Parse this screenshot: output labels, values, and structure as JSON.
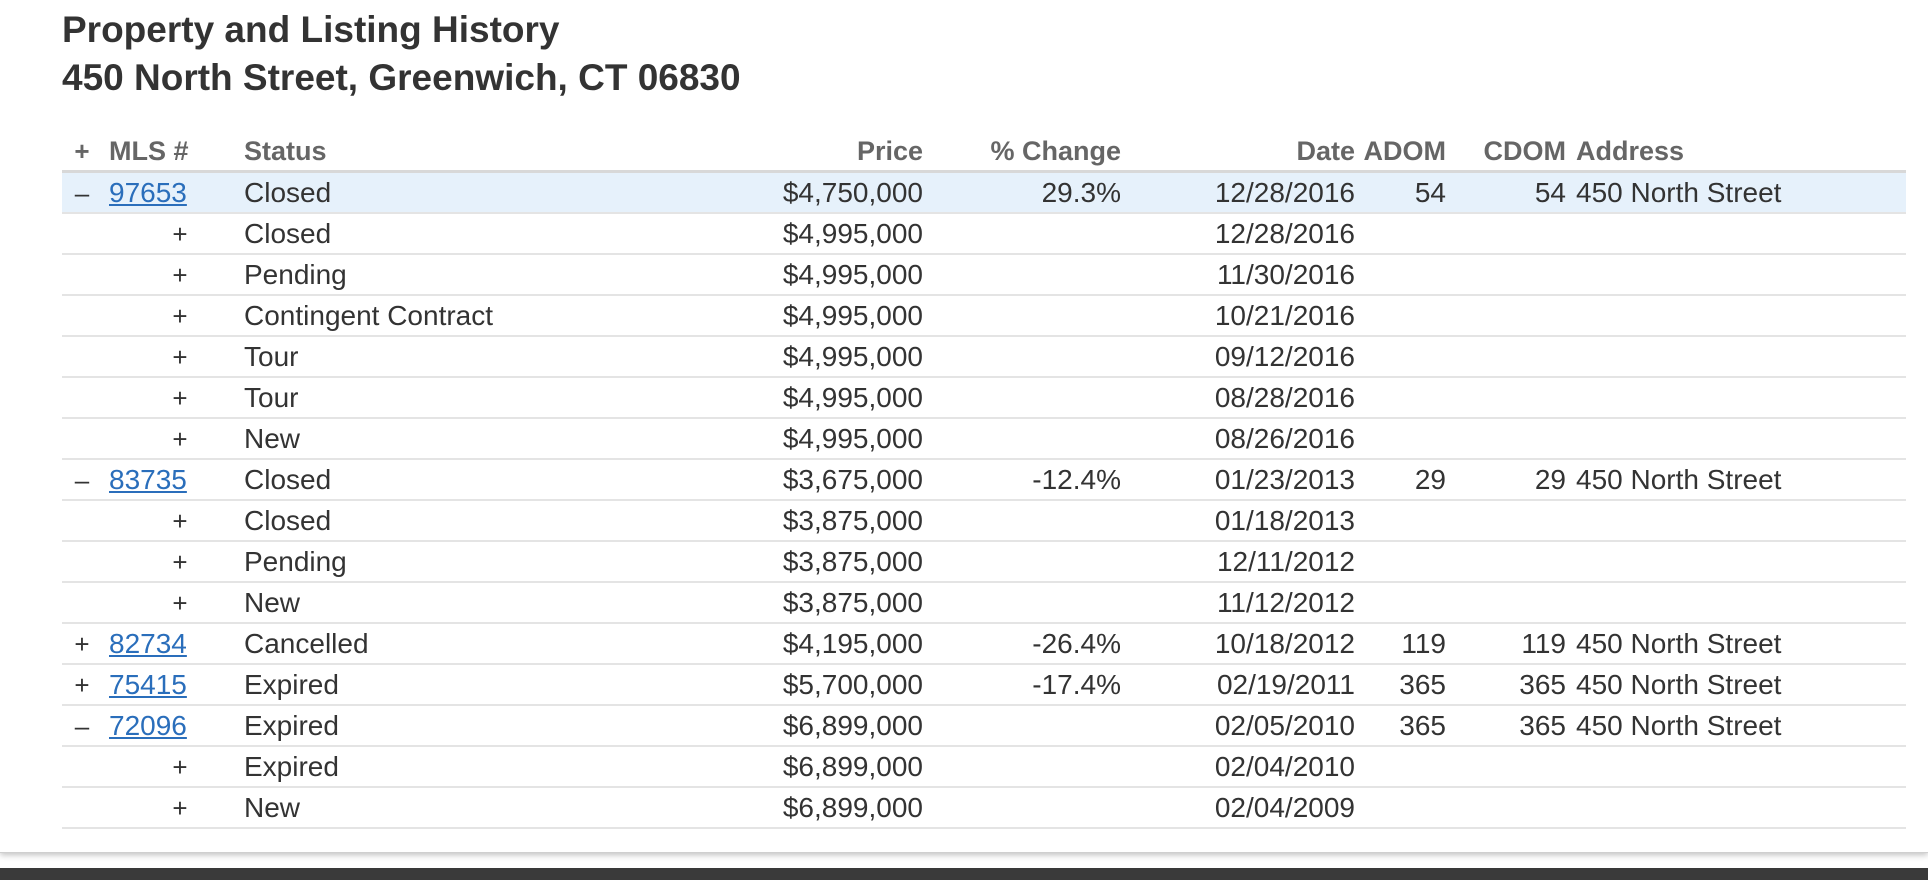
{
  "header": {
    "title": "Property and Listing History",
    "address": "450 North Street, Greenwich, CT 06830"
  },
  "table": {
    "columns": {
      "toggle": "+",
      "mls": "MLS #",
      "status": "Status",
      "price": "Price",
      "change": "% Change",
      "date": "Date",
      "adom": "ADOM",
      "cdom": "CDOM",
      "address": "Address"
    },
    "rows": [
      {
        "kind": "parent",
        "toggle": "–",
        "mls": "97653",
        "status": "Closed",
        "price": "$4,750,000",
        "change": "29.3%",
        "date": "12/28/2016",
        "adom": "54",
        "cdom": "54",
        "address": "450 North Street",
        "highlight": true
      },
      {
        "kind": "child",
        "toggle": "+",
        "status": "Closed",
        "price": "$4,995,000",
        "date": "12/28/2016"
      },
      {
        "kind": "child",
        "toggle": "+",
        "status": "Pending",
        "price": "$4,995,000",
        "date": "11/30/2016"
      },
      {
        "kind": "child",
        "toggle": "+",
        "status": "Contingent Contract",
        "price": "$4,995,000",
        "date": "10/21/2016"
      },
      {
        "kind": "child",
        "toggle": "+",
        "status": "Tour",
        "price": "$4,995,000",
        "date": "09/12/2016"
      },
      {
        "kind": "child",
        "toggle": "+",
        "status": "Tour",
        "price": "$4,995,000",
        "date": "08/28/2016"
      },
      {
        "kind": "child",
        "toggle": "+",
        "status": "New",
        "price": "$4,995,000",
        "date": "08/26/2016"
      },
      {
        "kind": "parent",
        "toggle": "–",
        "mls": "83735",
        "status": "Closed",
        "price": "$3,675,000",
        "change": "-12.4%",
        "date": "01/23/2013",
        "adom": "29",
        "cdom": "29",
        "address": "450 North Street"
      },
      {
        "kind": "child",
        "toggle": "+",
        "status": "Closed",
        "price": "$3,875,000",
        "date": "01/18/2013"
      },
      {
        "kind": "child",
        "toggle": "+",
        "status": "Pending",
        "price": "$3,875,000",
        "date": "12/11/2012"
      },
      {
        "kind": "child",
        "toggle": "+",
        "status": "New",
        "price": "$3,875,000",
        "date": "11/12/2012"
      },
      {
        "kind": "parent",
        "toggle": "+",
        "mls": "82734",
        "status": "Cancelled",
        "price": "$4,195,000",
        "change": "-26.4%",
        "date": "10/18/2012",
        "adom": "119",
        "cdom": "119",
        "address": "450 North Street"
      },
      {
        "kind": "parent",
        "toggle": "+",
        "mls": "75415",
        "status": "Expired",
        "price": "$5,700,000",
        "change": "-17.4%",
        "date": "02/19/2011",
        "adom": "365",
        "cdom": "365",
        "address": "450 North Street"
      },
      {
        "kind": "parent",
        "toggle": "–",
        "mls": "72096",
        "status": "Expired",
        "price": "$6,899,000",
        "change": "",
        "date": "02/05/2010",
        "adom": "365",
        "cdom": "365",
        "address": "450 North Street"
      },
      {
        "kind": "child",
        "toggle": "+",
        "status": "Expired",
        "price": "$6,899,000",
        "date": "02/04/2010"
      },
      {
        "kind": "child",
        "toggle": "+",
        "status": "New",
        "price": "$6,899,000",
        "date": "02/04/2009"
      }
    ]
  },
  "colors": {
    "link": "#2a6ebb",
    "highlight_row": "#e6f1fb",
    "text": "#333333",
    "header_text": "#666666"
  }
}
